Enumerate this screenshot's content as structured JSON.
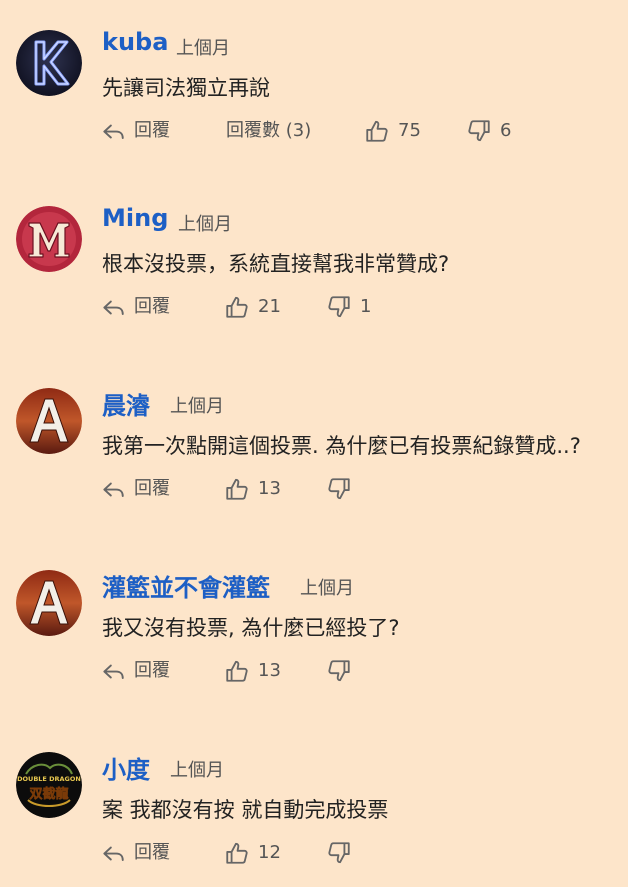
{
  "comments": [
    {
      "user": "kuba",
      "time": "上個月",
      "text": "先讓司法獨立再說",
      "reply_label": "回覆",
      "replies_label": "回覆數 (3)",
      "likes": "75",
      "dislikes": "6",
      "avatar_icon": "k-letter-avatar"
    },
    {
      "user": "Ming",
      "time": "上個月",
      "text": "根本沒投票，系統直接幫我非常贊成?",
      "reply_label": "回覆",
      "likes": "21",
      "dislikes": "1",
      "avatar_icon": "m-letter-avatar"
    },
    {
      "user": "晨濬",
      "time": "上個月",
      "text": "我第一次點開這個投票. 為什麼已有投票紀錄贊成..?",
      "reply_label": "回覆",
      "likes": "13",
      "dislikes": "",
      "avatar_icon": "a-letter-avatar"
    },
    {
      "user": "灌籃並不會灌籃",
      "time": "上個月",
      "text": "我又沒有投票, 為什麼已經投了?",
      "reply_label": "回覆",
      "likes": "13",
      "dislikes": "",
      "avatar_icon": "a-letter-avatar"
    },
    {
      "user": "小度",
      "time": "上個月",
      "text": "案 我都沒有按 就自動完成投票",
      "reply_label": "回覆",
      "likes": "12",
      "dislikes": "",
      "avatar_icon": "double-dragon-logo-avatar",
      "avatar_text": "DOUBLE DRAGON 双截龍"
    }
  ],
  "colors": {
    "background": "#fde5ca",
    "username": "#1d5fc5",
    "text": "#222222",
    "meta": "#555555"
  }
}
